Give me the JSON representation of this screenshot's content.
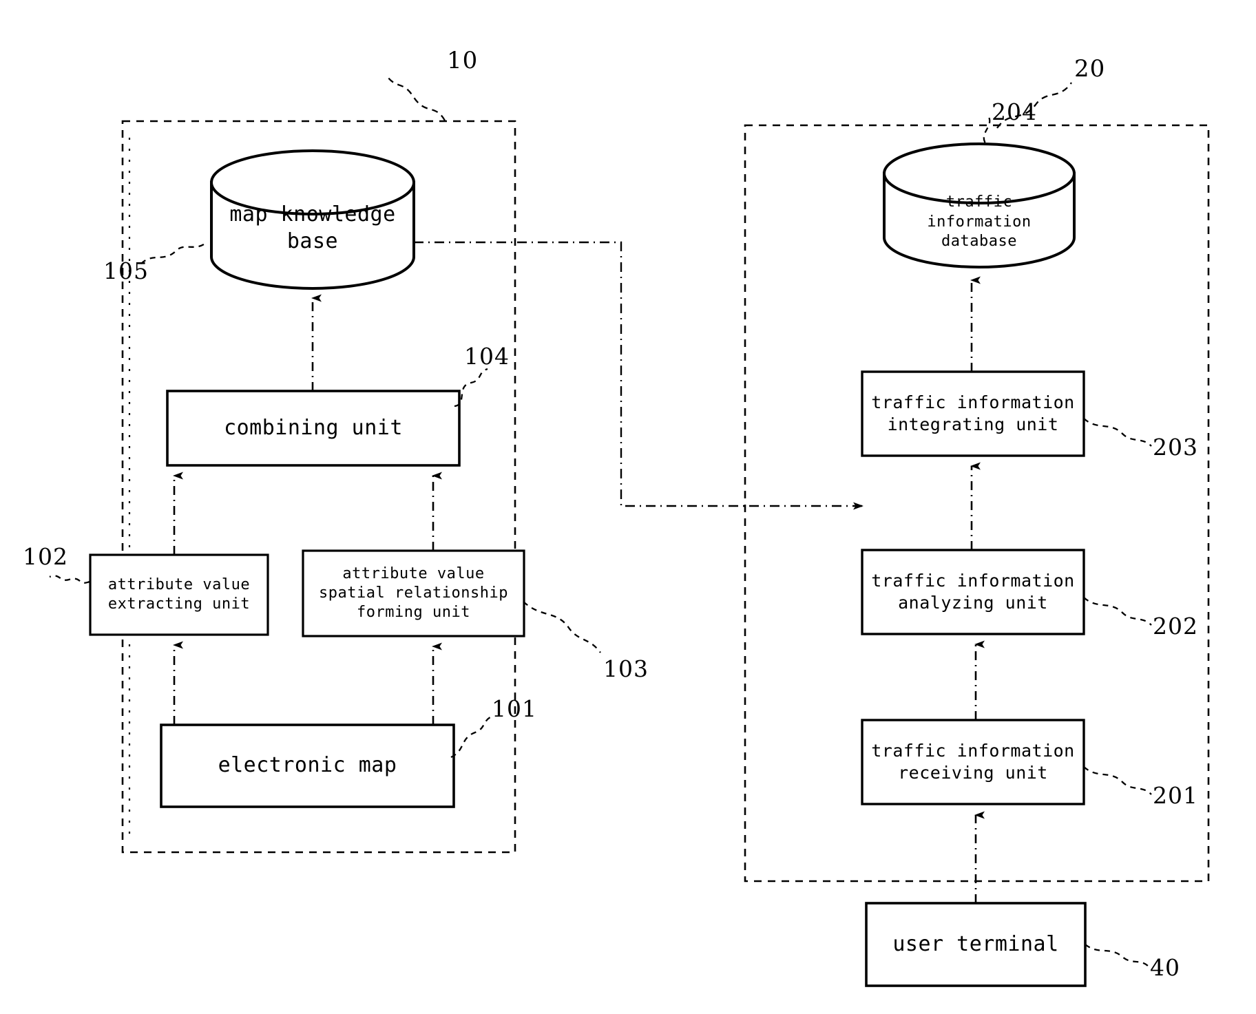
{
  "figure": {
    "type": "patent-block-diagram",
    "background_color": "#ffffff",
    "line_color": "#000000"
  },
  "left_system": {
    "ref_label": "10",
    "inner_ref_label": "105",
    "nodes": {
      "map_knowledge_base": {
        "label": "map knowledge\nbase",
        "shape": "cylinder",
        "ref_label": "105"
      },
      "combining_unit": {
        "label": "combining unit",
        "shape": "rect",
        "ref_label": "104"
      },
      "attribute_value_extracting_unit": {
        "label": "attribute value\nextracting unit",
        "shape": "rect",
        "ref_label": "102"
      },
      "attribute_value_spatial_relationship_forming_unit": {
        "label": "attribute value\nspatial relationship\nforming unit",
        "shape": "rect",
        "ref_label": "103"
      },
      "electronic_map": {
        "label": "electronic map",
        "shape": "rect",
        "ref_label": "101"
      }
    }
  },
  "right_system": {
    "ref_label": "20",
    "nodes": {
      "traffic_information_database": {
        "label": "traffic\ninformation\ndatabase",
        "shape": "cylinder",
        "ref_label": "204"
      },
      "traffic_information_integrating_unit": {
        "label": "traffic information\nintegrating unit",
        "shape": "rect",
        "ref_label": "203"
      },
      "traffic_information_analyzing_unit": {
        "label": "traffic information\nanalyzing unit",
        "shape": "rect",
        "ref_label": "202"
      },
      "traffic_information_receiving_unit": {
        "label": "traffic information\nreceiving unit",
        "shape": "rect",
        "ref_label": "201"
      }
    }
  },
  "external": {
    "user_terminal": {
      "label": "user terminal",
      "shape": "rect",
      "ref_label": "40"
    }
  },
  "connections": [
    {
      "from": "electronic_map",
      "to": "attribute_value_extracting_unit",
      "style": "dash-dot",
      "arrow": "up"
    },
    {
      "from": "electronic_map",
      "to": "attribute_value_spatial_relationship_forming_unit",
      "style": "dash-dot",
      "arrow": "up"
    },
    {
      "from": "attribute_value_extracting_unit",
      "to": "combining_unit",
      "style": "dash-dot",
      "arrow": "up"
    },
    {
      "from": "attribute_value_spatial_relationship_forming_unit",
      "to": "combining_unit",
      "style": "dash-dot",
      "arrow": "up"
    },
    {
      "from": "combining_unit",
      "to": "map_knowledge_base",
      "style": "dash-dot",
      "arrow": "up"
    },
    {
      "from": "map_knowledge_base",
      "to": "traffic_information_analyzing_unit",
      "style": "dash-dot",
      "arrow": "right"
    },
    {
      "from": "user_terminal",
      "to": "traffic_information_receiving_unit",
      "style": "dash-dot",
      "arrow": "up"
    },
    {
      "from": "traffic_information_receiving_unit",
      "to": "traffic_information_analyzing_unit",
      "style": "dash-dot",
      "arrow": "up"
    },
    {
      "from": "traffic_information_analyzing_unit",
      "to": "traffic_information_integrating_unit",
      "style": "dash-dot",
      "arrow": "up"
    },
    {
      "from": "traffic_information_integrating_unit",
      "to": "traffic_information_database",
      "style": "dash-dot",
      "arrow": "up"
    }
  ]
}
